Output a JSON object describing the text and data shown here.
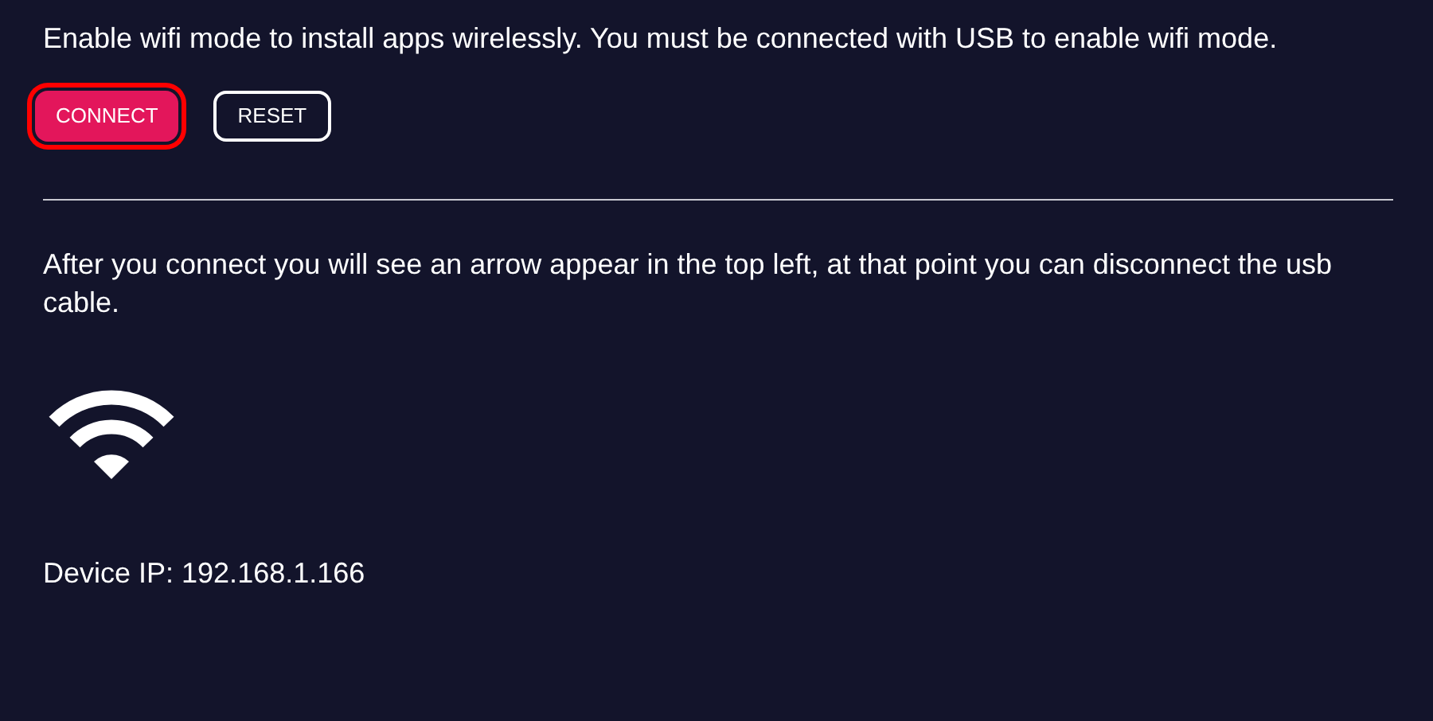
{
  "intro": "Enable wifi mode to install apps wirelessly. You must be connected with USB to enable wifi mode.",
  "buttons": [
    {
      "label": "CONNECT",
      "kind": "primary",
      "focused": true
    },
    {
      "label": "RESET",
      "kind": "outline",
      "focused": false
    }
  ],
  "note": "After you connect you will see an arrow appear in the top left, at that point you can disconnect the usb cable.",
  "device_ip": "Device IP: 192.168.1.166"
}
